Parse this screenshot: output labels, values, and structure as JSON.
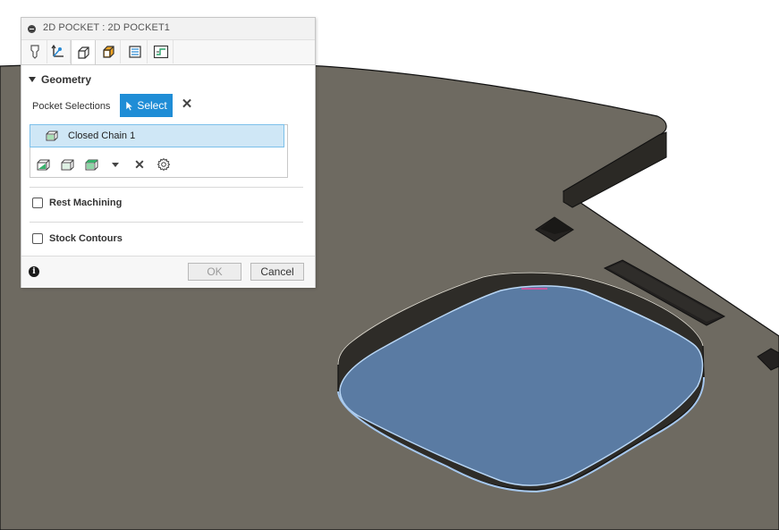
{
  "colors": {
    "model_surface": "#6e6a61",
    "pocket_fill": "#5a7ba3",
    "selection_outline": "#9fc2ea",
    "accent": "#1f8dd6",
    "selected_row_bg": "#cfe7f6"
  },
  "dialog": {
    "title": "2D POCKET : 2D POCKET1",
    "tabs": [
      {
        "name": "tool",
        "icon": "tool-icon"
      },
      {
        "name": "setup",
        "icon": "axes-icon"
      },
      {
        "name": "geometry",
        "icon": "geometry-icon",
        "active": true
      },
      {
        "name": "heights",
        "icon": "heights-icon"
      },
      {
        "name": "passes",
        "icon": "passes-icon"
      },
      {
        "name": "linking",
        "icon": "linking-icon"
      }
    ],
    "geometry": {
      "section_label": "Geometry",
      "pocket_selections_label": "Pocket Selections",
      "select_button_label": "Select",
      "selections": [
        "Closed Chain 1"
      ]
    },
    "rest_machining": {
      "label": "Rest Machining",
      "checked": false
    },
    "stock_contours": {
      "label": "Stock Contours",
      "checked": false
    },
    "footer": {
      "ok_label": "OK",
      "cancel_label": "Cancel"
    }
  }
}
